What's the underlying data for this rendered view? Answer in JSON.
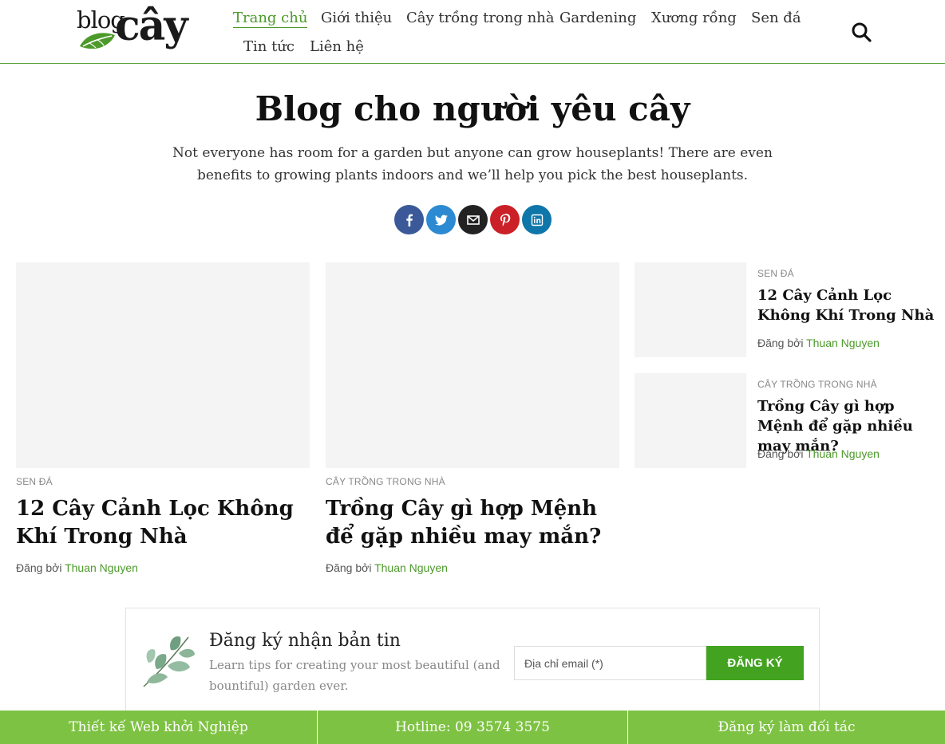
{
  "logo": {
    "text_blog": "blog",
    "text_cay": "cây",
    "leaf_color": "#4c9a2a"
  },
  "nav": {
    "items": [
      {
        "label": "Trang chủ",
        "active": true
      },
      {
        "label": "Giới thiệu"
      },
      {
        "label": "Cây trồng trong nhà"
      },
      {
        "label": "Gardening"
      },
      {
        "label": "Xương rồng"
      },
      {
        "label": "Sen đá"
      },
      {
        "label": "Tin tức"
      },
      {
        "label": "Liên hệ"
      }
    ],
    "search_icon": "search-icon"
  },
  "hero": {
    "title": "Blog cho người yêu cây",
    "subtitle": "Not everyone has room for a garden but anyone can grow houseplants! There are even benefits to growing plants indoors and we’ll help you pick the best houseplants."
  },
  "share": [
    {
      "icon": "facebook-icon",
      "color": "#3b5998"
    },
    {
      "icon": "twitter-icon",
      "color": "#2b8ad1"
    },
    {
      "icon": "email-icon",
      "color": "#222222"
    },
    {
      "icon": "pinterest-icon",
      "color": "#cb2027"
    },
    {
      "icon": "linkedin-icon",
      "color": "#0e76a8"
    }
  ],
  "posts": [
    {
      "category": "SEN ĐÁ",
      "title": "12 Cây Cảnh Lọc Không Khí Trong Nhà",
      "byline_prefix": "Đăng bởi",
      "author": "Thuan Nguyen"
    },
    {
      "category": "CÂY TRỒNG TRONG NHÀ",
      "title": "Trồng Cây gì hợp Mệnh để gặp nhiều may mắn?",
      "byline_prefix": "Đăng bởi",
      "author": "Thuan Nguyen"
    },
    {
      "category": "SEN ĐÁ",
      "title": "12 Cây Cảnh Lọc Không Khí Trong Nhà",
      "byline_prefix": "Đăng bởi",
      "author": "Thuan Nguyen"
    },
    {
      "category": "CÂY TRỒNG TRONG NHÀ",
      "title": "Trồng Cây gì hợp Mệnh để gặp nhiều may mắn?",
      "byline_prefix": "Đăng bởi",
      "author": "Thuan Nguyen"
    }
  ],
  "newsletter": {
    "title": "Đăng ký nhận bản tin",
    "description": "Learn tips for creating your most beautiful (and bountiful) garden ever.",
    "email_placeholder": "Địa chỉ email (*)",
    "button_label": "ĐĂNG KÝ"
  },
  "footer": {
    "items": [
      {
        "label": "Thiết kế Web khởi Nghiệp"
      },
      {
        "label": "Hotline: 09 3574 3575"
      },
      {
        "label": "Đăng ký làm đối tác"
      }
    ],
    "bg_color": "#7ec243"
  },
  "colors": {
    "accent": "#4c9a2a",
    "button": "#43a320"
  }
}
